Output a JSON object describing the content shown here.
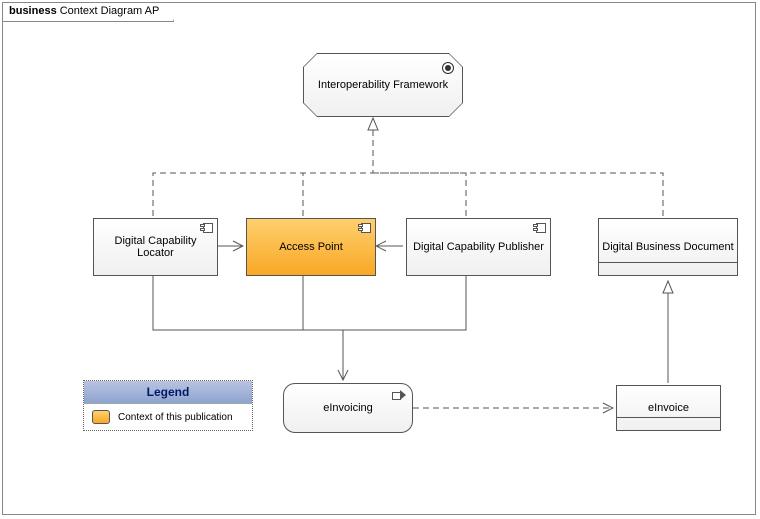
{
  "frame_title_prefix": "business",
  "frame_title": "Context Diagram AP",
  "nodes": {
    "interop": "Interoperability Framework",
    "dcl": "Digital Capability Locator",
    "ap": "Access Point",
    "dcp": "Digital Capability Publisher",
    "dbd": "Digital Business Document",
    "einvoicing": "eInvoicing",
    "einvoice": "eInvoice"
  },
  "legend": {
    "title": "Legend",
    "item1": "Context of this publication"
  }
}
